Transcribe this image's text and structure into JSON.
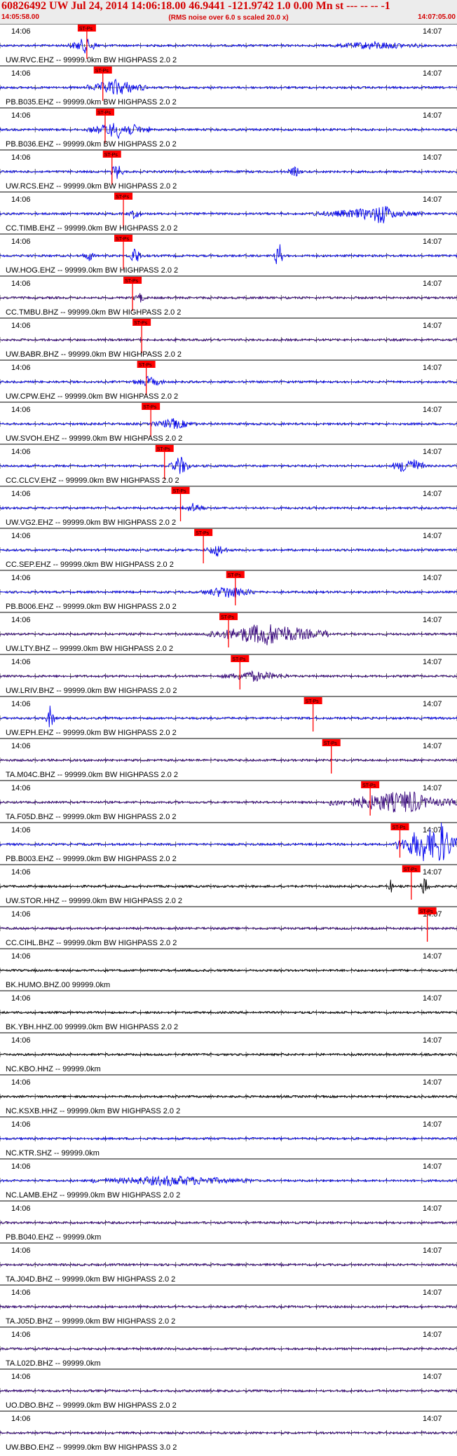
{
  "header": {
    "title": "60826492 UW Jul 24, 2014 14:06:18.00   46.9441 -121.9742  1.0 0.00 Mn st --- -- --   -1",
    "start_time": "14:05:58.00",
    "subtitle": "(RMS noise over 6.0 s scaled 20.0 x)",
    "end_time": "14:07:05.00"
  },
  "chart_data": {
    "type": "line",
    "x_tick_labels": [
      "14:06",
      "14:07"
    ],
    "pick_label": "ST-Ps",
    "colors": {
      "blue": "#0000ee",
      "indigo": "#33007a",
      "black": "#000000",
      "pick": "#ff0000"
    },
    "traces": [
      {
        "label": "UW.RVC.EHZ -- 99999.0km BW  HIGHPASS  2.0  2",
        "color": "blue",
        "pick": 0.19,
        "bursts": [
          [
            0.15,
            0.22,
            4.5
          ],
          [
            0.72,
            0.92,
            2.2
          ]
        ]
      },
      {
        "label": "PB.B035.EHZ -- 99999.0km BW  HIGHPASS  2.0  2",
        "color": "blue",
        "pick": 0.225,
        "bursts": [
          [
            0.19,
            0.32,
            5
          ]
        ]
      },
      {
        "label": "PB.B036.EHZ -- 99999.0km BW  HIGHPASS  2.0  2",
        "color": "blue",
        "pick": 0.23,
        "bursts": [
          [
            0.19,
            0.33,
            5
          ]
        ]
      },
      {
        "label": "UW.RCS.EHZ -- 99999.0km BW  HIGHPASS  2.0  2",
        "color": "blue",
        "pick": 0.245,
        "bursts": [
          [
            0.24,
            0.27,
            5
          ],
          [
            0.63,
            0.66,
            3
          ]
        ]
      },
      {
        "label": "CC.TIMB.EHZ -- 99999.0km BW  HIGHPASS  2.0  2",
        "color": "blue",
        "pick": 0.27,
        "bursts": [
          [
            0.28,
            0.31,
            3
          ],
          [
            0.68,
            0.93,
            3
          ],
          [
            0.8,
            0.87,
            7
          ]
        ]
      },
      {
        "label": "UW.HOG.EHZ -- 99999.0km BW  HIGHPASS  2.0  2",
        "color": "blue",
        "pick": 0.27,
        "bursts": [
          [
            0.18,
            0.21,
            3
          ],
          [
            0.28,
            0.31,
            6
          ],
          [
            0.6,
            0.62,
            10
          ]
        ]
      },
      {
        "label": "CC.TMBU.BHZ -- 99999.0km BW  HIGHPASS  2.0  2",
        "color": "indigo",
        "pick": 0.29,
        "bursts": [
          [
            0.29,
            0.32,
            3
          ]
        ]
      },
      {
        "label": "UW.BABR.BHZ -- 99999.0km BW  HIGHPASS  2.0  2",
        "color": "indigo",
        "pick": 0.31,
        "bursts": []
      },
      {
        "label": "UW.CPW.EHZ -- 99999.0km BW  HIGHPASS  2.0  2",
        "color": "blue",
        "pick": 0.32,
        "bursts": [
          [
            0.29,
            0.36,
            3
          ]
        ]
      },
      {
        "label": "UW.SVOH.EHZ -- 99999.0km BW  HIGHPASS  2.0  2",
        "color": "blue",
        "pick": 0.33,
        "bursts": [
          [
            0.33,
            0.43,
            3
          ]
        ]
      },
      {
        "label": "CC.CLCV.EHZ -- 99999.0km BW  HIGHPASS  2.0  2",
        "color": "blue",
        "pick": 0.36,
        "bursts": [
          [
            0.37,
            0.42,
            6
          ],
          [
            0.86,
            0.93,
            6
          ]
        ]
      },
      {
        "label": "UW.VG2.EHZ -- 99999.0km BW  HIGHPASS  2.0  2",
        "color": "blue",
        "pick": 0.395,
        "bursts": [
          [
            0.4,
            0.45,
            3
          ]
        ]
      },
      {
        "label": "CC.SEP.EHZ -- 99999.0km BW  HIGHPASS  2.0  2",
        "color": "blue",
        "pick": 0.445,
        "bursts": [
          [
            0.45,
            0.5,
            4
          ]
        ]
      },
      {
        "label": "PB.B006.EHZ -- 99999.0km BW  HIGHPASS  2.0  2",
        "color": "blue",
        "pick": 0.515,
        "bursts": [
          [
            0.44,
            0.56,
            4
          ]
        ]
      },
      {
        "label": "UW.LTY.BHZ -- 99999.0km BW  HIGHPASS  2.0  2",
        "color": "indigo",
        "pick": 0.5,
        "bursts": [
          [
            0.45,
            0.72,
            7
          ]
        ]
      },
      {
        "label": "UW.LRIV.BHZ -- 99999.0km BW  HIGHPASS  2.0  2",
        "color": "indigo",
        "pick": 0.525,
        "bursts": [
          [
            0.48,
            0.63,
            3
          ]
        ]
      },
      {
        "label": "UW.EPH.EHZ -- 99999.0km BW  HIGHPASS  2.0  2",
        "color": "blue",
        "pick": 0.685,
        "bursts": [
          [
            0.1,
            0.12,
            8
          ]
        ]
      },
      {
        "label": "TA.M04C.BHZ -- 99999.0km BW  HIGHPASS  2.0  2",
        "color": "indigo",
        "pick": 0.725,
        "bursts": []
      },
      {
        "label": "TA.F05D.BHZ -- 99999.0km BW  HIGHPASS  2.0  2",
        "color": "indigo",
        "pick": 0.81,
        "bursts": [
          [
            0.72,
            1.0,
            6
          ],
          [
            0.84,
            0.95,
            8
          ]
        ]
      },
      {
        "label": "PB.B003.EHZ -- 99999.0km BW  HIGHPASS  2.0  2",
        "color": "blue",
        "pick": 0.875,
        "bursts": [
          [
            0.86,
            1.0,
            11
          ],
          [
            0.93,
            1.0,
            14
          ]
        ]
      },
      {
        "label": "UW.STOR.HHZ -- 99999.0km BW  HIGHPASS  2.0  2",
        "color": "black",
        "pick": 0.9,
        "bursts": [
          [
            0.85,
            0.86,
            5
          ],
          [
            0.92,
            0.94,
            7
          ]
        ]
      },
      {
        "label": "CC.CIHL.BHZ -- 99999.0km BW  HIGHPASS  2.0  2",
        "color": "indigo",
        "pick": 0.935,
        "bursts": []
      },
      {
        "label": "BK.HUMO.BHZ.00 99999.0km",
        "color": "black",
        "pick": null,
        "bursts": []
      },
      {
        "label": "BK.YBH.HHZ.00 99999.0km BW  HIGHPASS  2.0  2",
        "color": "black",
        "pick": null,
        "bursts": []
      },
      {
        "label": "NC.KBO.HHZ -- 99999.0km",
        "color": "black",
        "pick": null,
        "bursts": []
      },
      {
        "label": "NC.KSXB.HHZ -- 99999.0km BW  HIGHPASS  2.0  2",
        "color": "black",
        "pick": null,
        "bursts": []
      },
      {
        "label": "NC.KTR.SHZ -- 99999.0km",
        "color": "blue",
        "pick": null,
        "bursts": []
      },
      {
        "label": "NC.LAMB.EHZ -- 99999.0km BW  HIGHPASS  2.0  2",
        "color": "blue",
        "pick": null,
        "bursts": [
          [
            0.2,
            0.55,
            3
          ]
        ]
      },
      {
        "label": "PB.B040.EHZ -- 99999.0km",
        "color": "indigo",
        "pick": null,
        "bursts": []
      },
      {
        "label": "TA.J04D.BHZ -- 99999.0km BW  HIGHPASS  2.0  2",
        "color": "indigo",
        "pick": null,
        "bursts": []
      },
      {
        "label": "TA.J05D.BHZ -- 99999.0km BW  HIGHPASS  2.0  2",
        "color": "indigo",
        "pick": null,
        "bursts": []
      },
      {
        "label": "TA.L02D.BHZ -- 99999.0km",
        "color": "indigo",
        "pick": null,
        "bursts": []
      },
      {
        "label": "UO.DBO.BHZ -- 99999.0km BW  HIGHPASS  2.0  2",
        "color": "indigo",
        "pick": null,
        "bursts": []
      },
      {
        "label": "UW.BBO.EHZ -- 99999.0km BW  HIGHPASS  3.0  2",
        "color": "indigo",
        "pick": null,
        "bursts": []
      }
    ]
  }
}
